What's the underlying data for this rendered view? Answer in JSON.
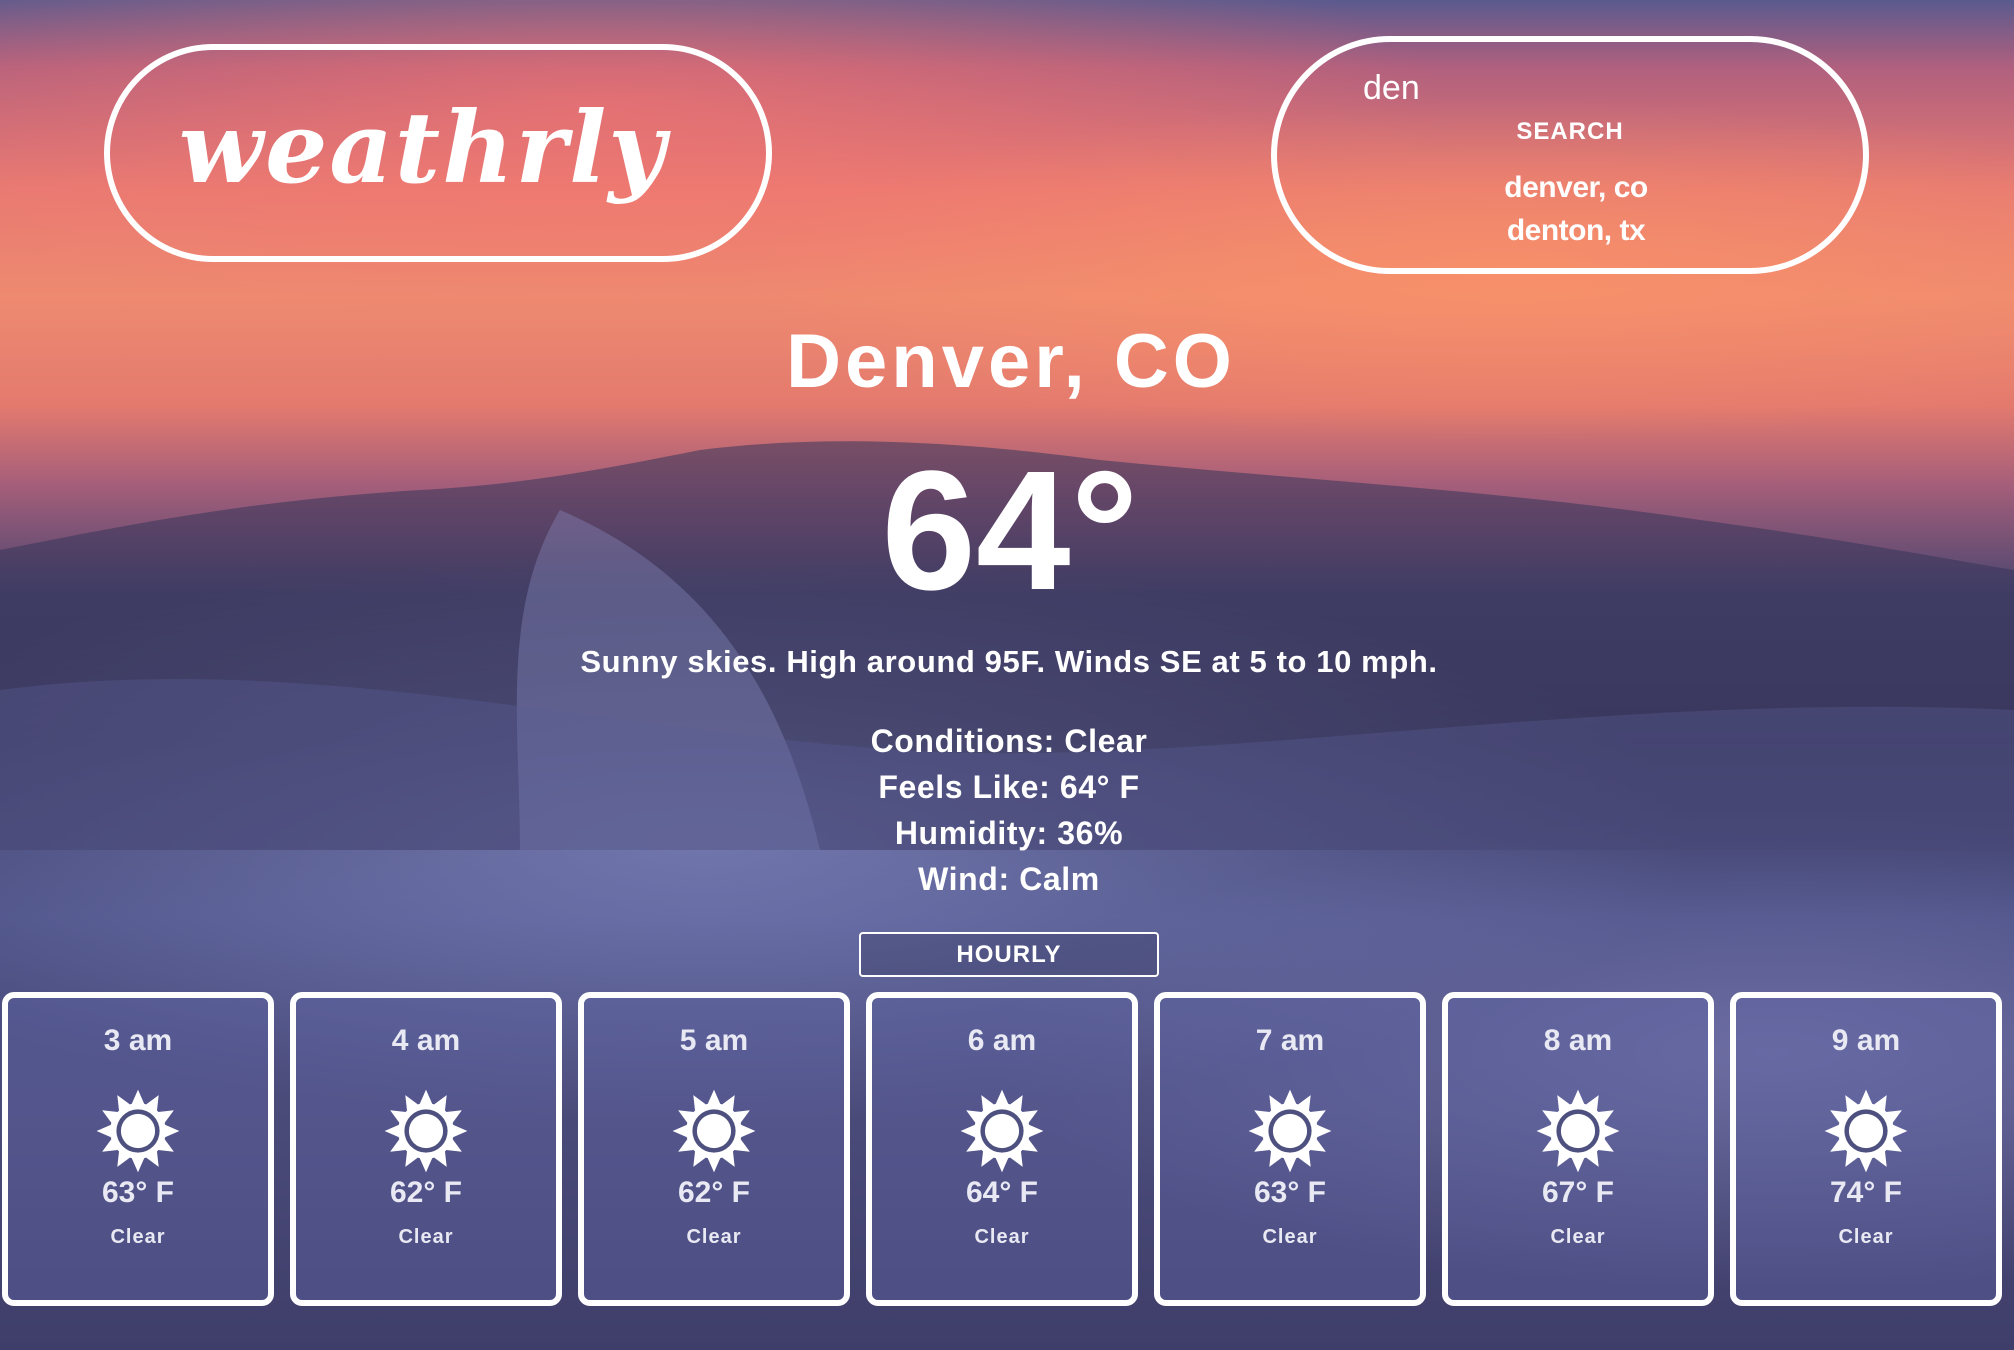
{
  "brand": {
    "logo_text": "weathrly"
  },
  "search": {
    "value": "den",
    "placeholder": "",
    "button_label": "SEARCH",
    "suggestions": [
      "denver, co",
      "denton, tx"
    ]
  },
  "current": {
    "location": "Denver, CO",
    "temperature": "64°",
    "summary": "Sunny skies. High around 95F. Winds SE at 5 to 10 mph.",
    "conditions": "Conditions: Clear",
    "feels_like": "Feels Like: 64° F",
    "humidity": "Humidity: 36%",
    "wind": "Wind: Calm"
  },
  "forecast_toggle": {
    "label": "HOURLY"
  },
  "hourly": [
    {
      "time": "3 am",
      "icon": "sun-icon",
      "temp": "63° F",
      "condition": "Clear"
    },
    {
      "time": "4 am",
      "icon": "sun-icon",
      "temp": "62° F",
      "condition": "Clear"
    },
    {
      "time": "5 am",
      "icon": "sun-icon",
      "temp": "62° F",
      "condition": "Clear"
    },
    {
      "time": "6 am",
      "icon": "sun-icon",
      "temp": "64° F",
      "condition": "Clear"
    },
    {
      "time": "7 am",
      "icon": "sun-icon",
      "temp": "63° F",
      "condition": "Clear"
    },
    {
      "time": "8 am",
      "icon": "sun-icon",
      "temp": "67° F",
      "condition": "Clear"
    },
    {
      "time": "9 am",
      "icon": "sun-icon",
      "temp": "74° F",
      "condition": "Clear"
    }
  ],
  "colors": {
    "text": "#ffffff",
    "card_text": "#e9e9f4",
    "card_background": "#5f64a5"
  }
}
